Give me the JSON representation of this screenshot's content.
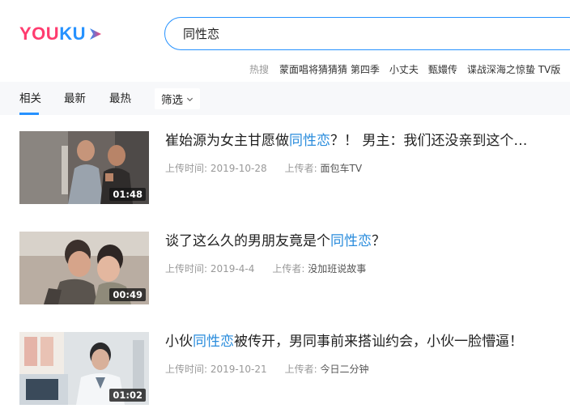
{
  "logo": {
    "text_you": "YOU",
    "text_ku": "KU",
    "brand_colors": {
      "primary": "#ff3c6f",
      "secondary": "#2692ff"
    }
  },
  "search": {
    "value": "同性恋"
  },
  "hot": {
    "label": "热搜",
    "items": [
      "蒙面唱将猜猜猜 第四季",
      "小丈夫",
      "甄嬛传",
      "谍战深海之惊蛰 TV版"
    ]
  },
  "tabs": {
    "items": [
      "相关",
      "最新",
      "最热"
    ],
    "active_index": 0,
    "filter_label": "筛选"
  },
  "results": [
    {
      "title_before": "崔始源为女主甘愿做",
      "title_highlight": "同性恋",
      "title_after": "？！ 男主：我们还没亲到这个…",
      "upload_label": "上传时间:",
      "upload_time": "2019-10-28",
      "uploader_label": "上传者:",
      "uploader": "面包车TV",
      "duration": "01:48"
    },
    {
      "title_before": "谈了这么久的男朋友竟是个",
      "title_highlight": "同性恋",
      "title_after": "？",
      "upload_label": "上传时间:",
      "upload_time": "2019-4-4",
      "uploader_label": "上传者:",
      "uploader": "没加班说故事",
      "duration": "00:49"
    },
    {
      "title_before": "小伙",
      "title_highlight": "同性恋",
      "title_after": "被传开，男同事前来搭讪约会，小伙一脸懵逼！",
      "upload_label": "上传时间:",
      "upload_time": "2019-10-21",
      "uploader_label": "上传者:",
      "uploader": "今日二分钟",
      "duration": "01:02"
    }
  ]
}
